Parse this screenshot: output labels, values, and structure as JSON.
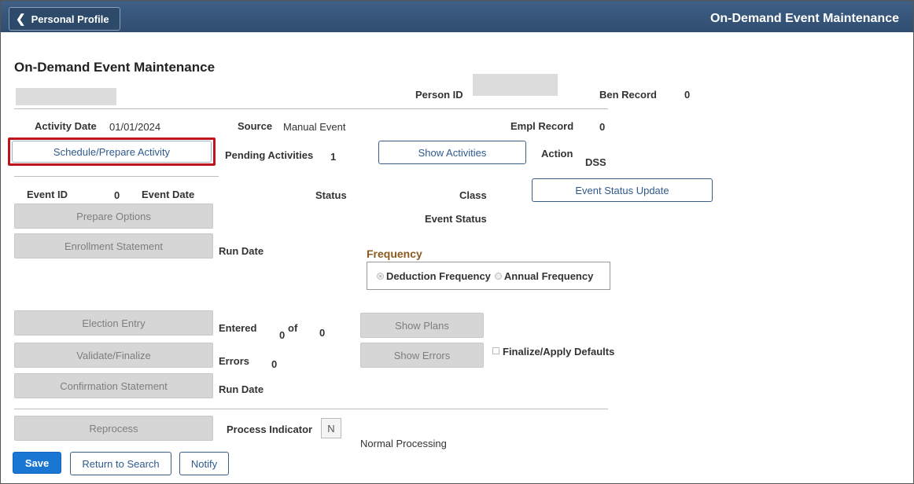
{
  "header": {
    "back_label": "Personal Profile",
    "title": "On-Demand Event Maintenance"
  },
  "page_title": "On-Demand Event Maintenance",
  "person": {
    "person_id_label": "Person ID",
    "ben_record_label": "Ben Record",
    "ben_record_value": "0"
  },
  "activity": {
    "activity_date_label": "Activity Date",
    "activity_date_value": "01/01/2024",
    "source_label": "Source",
    "source_value": "Manual Event",
    "empl_record_label": "Empl Record",
    "empl_record_value": "0",
    "schedule_button": "Schedule/Prepare Activity",
    "pending_label": "Pending Activities",
    "pending_value": "1",
    "show_activities_button": "Show Activities",
    "action_label": "Action",
    "action_value": "DSS"
  },
  "event": {
    "event_id_label": "Event ID",
    "event_id_value": "0",
    "event_date_label": "Event Date",
    "status_label": "Status",
    "class_label": "Class",
    "event_status_update_button": "Event Status Update",
    "event_status_label": "Event Status",
    "prepare_options_button": "Prepare Options",
    "enrollment_statement_button": "Enrollment Statement",
    "run_date_label": "Run Date"
  },
  "frequency": {
    "title": "Frequency",
    "options": [
      "Deduction Frequency",
      "Annual Frequency"
    ],
    "selected": "Deduction Frequency"
  },
  "election": {
    "election_entry_button": "Election Entry",
    "entered_label": "Entered",
    "entered_value": "0",
    "of_label": "of",
    "of_value": "0",
    "show_plans_button": "Show Plans",
    "validate_button": "Validate/Finalize",
    "errors_label": "Errors",
    "errors_value": "0",
    "show_errors_button": "Show Errors",
    "finalize_defaults_label": "Finalize/Apply Defaults",
    "confirmation_button": "Confirmation Statement",
    "run_date_label": "Run Date"
  },
  "process": {
    "reprocess_button": "Reprocess",
    "indicator_label": "Process Indicator",
    "indicator_value": "N",
    "indicator_desc": "Normal Processing"
  },
  "footer": {
    "save": "Save",
    "return_to_search": "Return to Search",
    "notify": "Notify"
  },
  "colors": {
    "header_bg": "#34567c",
    "primary": "#1976d2",
    "highlight": "#c0141c",
    "frequency_title": "#8a5a1e"
  }
}
